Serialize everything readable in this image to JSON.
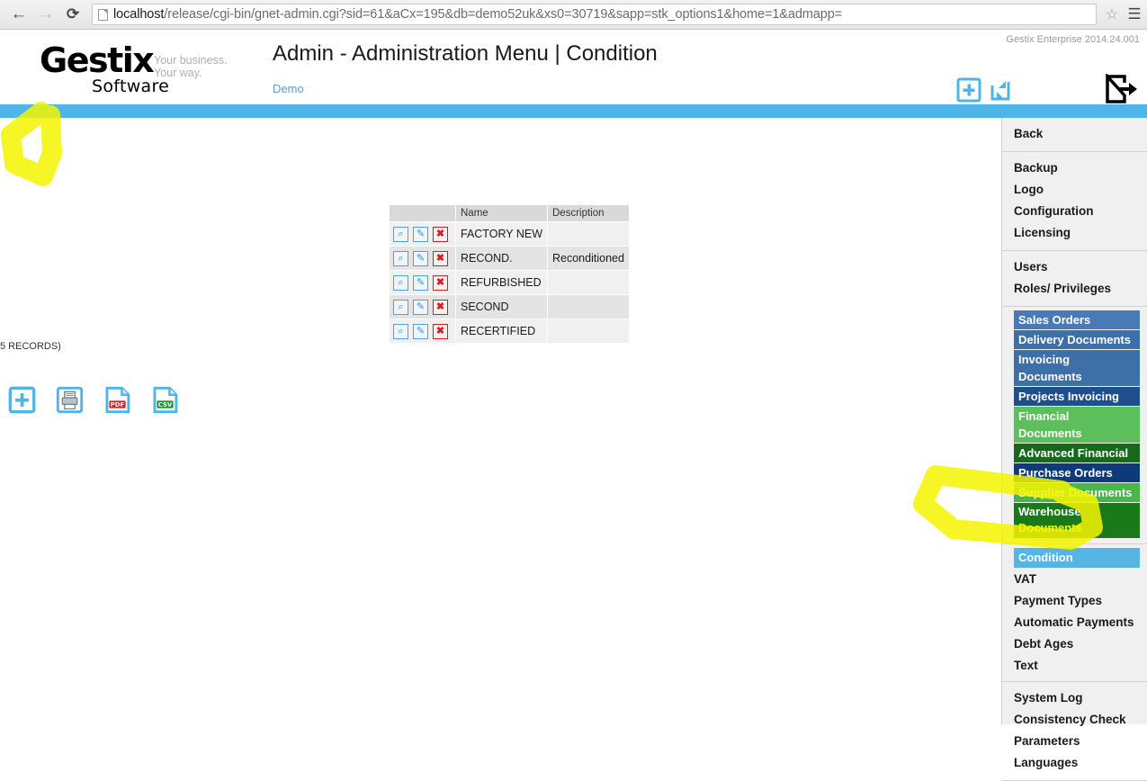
{
  "browser": {
    "back_icon": "arrow-left-icon",
    "forward_icon": "arrow-right-icon",
    "reload_icon": "reload-icon",
    "url_host": "localhost",
    "url_path": "/release/cgi-bin/gnet-admin.cgi?sid=61&aCx=195&db=demo52uk&xs0=30719&sapp=stk_options1&home=1&admapp=",
    "url_full": "localhost/release/cgi-bin/gnet-admin.cgi?sid=61&aCx=195&db=demo52uk&xs0=30719&sapp=stk_options1&home=1&admapp=",
    "star_icon": "bookmark-star-icon",
    "menu_icon": "hamburger-menu-icon"
  },
  "header": {
    "logo_name": "Gestix",
    "logo_sub": "Software",
    "tagline_line1": "Your business.",
    "tagline_line2": "Your way.",
    "title": "Admin - Administration Menu | Condition",
    "company": "Demo",
    "version": "Gestix Enterprise 2014.24.001",
    "add_icon": "add-plus-icon",
    "refresh_icon": "refresh-sync-icon",
    "logout_icon": "logout-icon"
  },
  "toolbar": {
    "items": [
      {
        "label": "New",
        "icon": "new-plus-icon"
      },
      {
        "label": "Print",
        "icon": "printer-icon"
      },
      {
        "label": "PDF",
        "icon": "pdf-file-icon"
      },
      {
        "label": "Worksheet/CSV",
        "icon": "csv-file-icon"
      }
    ]
  },
  "footer_toolbar": {
    "items": [
      {
        "icon": "new-plus-icon"
      },
      {
        "icon": "printer-icon"
      },
      {
        "icon": "pdf-file-icon"
      },
      {
        "icon": "csv-file-icon"
      }
    ]
  },
  "table": {
    "columns": [
      "",
      "Name",
      "Description"
    ],
    "row_actions": [
      {
        "icon": "view-magnifier-icon",
        "glyph": "⌕"
      },
      {
        "icon": "edit-pencil-icon",
        "glyph": "✎"
      },
      {
        "icon": "delete-x-icon",
        "glyph": "✖"
      }
    ],
    "rows": [
      {
        "name": "FACTORY NEW",
        "description": ""
      },
      {
        "name": "RECOND.",
        "description": "Reconditioned"
      },
      {
        "name": "REFURBISHED",
        "description": ""
      },
      {
        "name": "SECOND",
        "description": ""
      },
      {
        "name": "RECERTIFIED",
        "description": ""
      }
    ],
    "records_label": "5 RECORDS)"
  },
  "sidebar": {
    "back": "Back",
    "group_admin": [
      "Backup",
      "Logo",
      "Configuration",
      "Licensing"
    ],
    "group_users": [
      "Users",
      "Roles/ Privileges"
    ],
    "group_bars": [
      {
        "label": "Sales Orders",
        "color": "#4a7ab5",
        "text_color": "#ffffff"
      },
      {
        "label": "Delivery Documents",
        "color": "#3d6fa8",
        "text_color": "#ffffff"
      },
      {
        "label": "Invoicing Documents",
        "color": "#3d6fa8",
        "text_color": "#ffffff"
      },
      {
        "label": "Projects Invoicing",
        "color": "#1f4e8c",
        "text_color": "#ffffff"
      },
      {
        "label": "Financial Documents",
        "color": "#5cbf5c",
        "text_color": "#ffffff"
      },
      {
        "label": "Advanced Financial",
        "color": "#15691a",
        "text_color": "#ffffff"
      },
      {
        "label": "Purchase Orders",
        "color": "#0d3b7a",
        "text_color": "#ffffff"
      },
      {
        "label": "Supplier Documents",
        "color": "#4db34d",
        "text_color": "#ffffff"
      }
    ],
    "warehouse_line1": "Warehouse",
    "warehouse_line2": "Documents",
    "warehouse_color": "#1a7a1a",
    "selected_item": "Condition",
    "selected_color": "#57b5e3",
    "group_settings": [
      "VAT",
      "Payment Types",
      "Automatic Payments",
      "Debt Ages",
      "Text"
    ],
    "group_system": [
      "System Log",
      "Consistency Check",
      "Parameters",
      "Languages"
    ]
  },
  "annotations": {
    "highlight_color": "#f5f500",
    "marks": [
      "circle-around-new-button",
      "lasso-around-condition-menu-item"
    ]
  }
}
